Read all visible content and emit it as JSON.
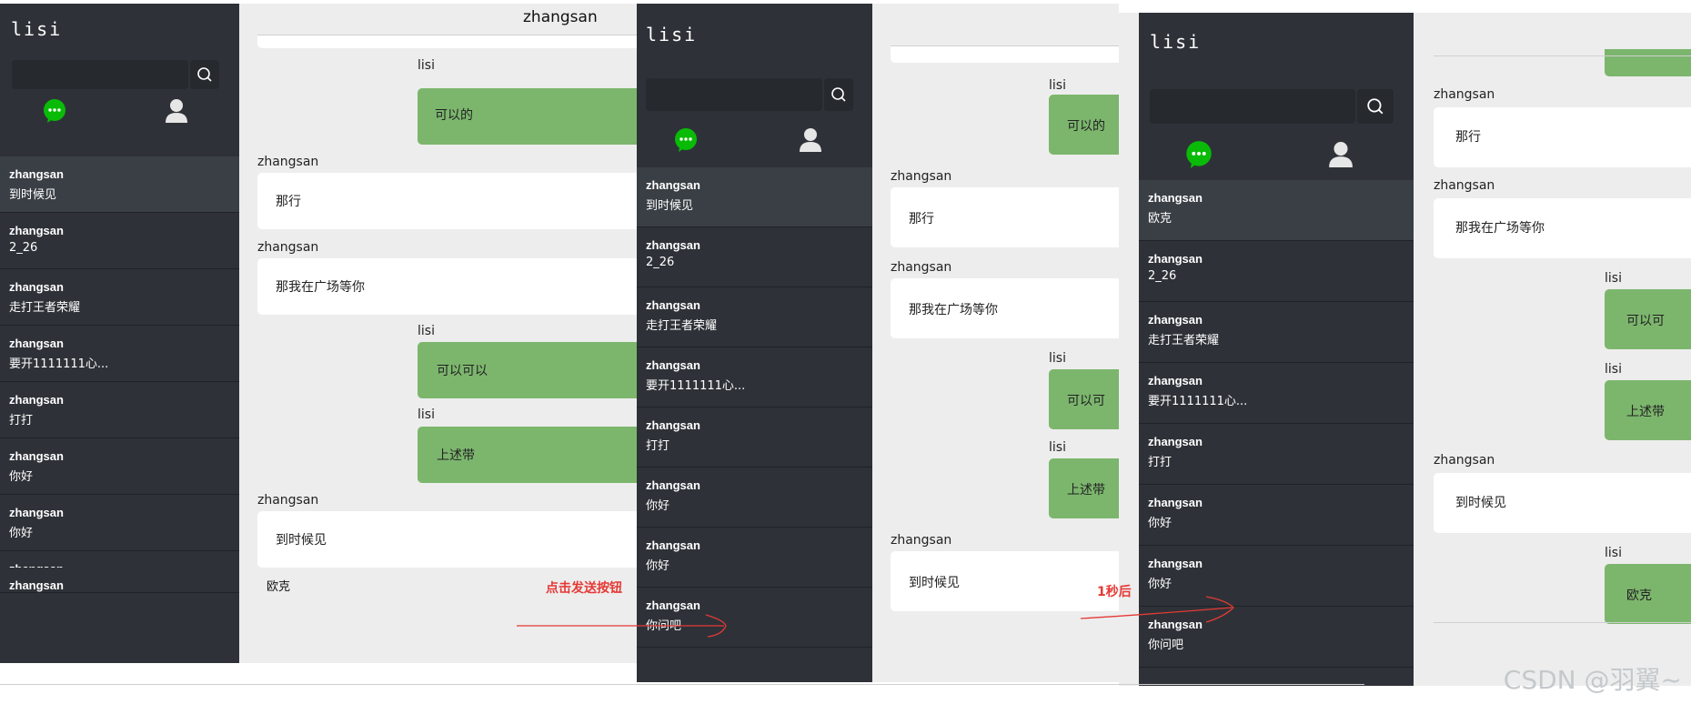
{
  "owner": "lisi",
  "chat_partner": "zhangsan",
  "sidebar_items": [
    {
      "name": "zhangsan",
      "preview": "到时候见"
    },
    {
      "name": "zhangsan",
      "preview": "2_26"
    },
    {
      "name": "zhangsan",
      "preview": "走打王者荣耀"
    },
    {
      "name": "zhangsan",
      "preview": "要开1111111心..."
    },
    {
      "name": "zhangsan",
      "preview": "打打"
    },
    {
      "name": "zhangsan",
      "preview": "你好"
    },
    {
      "name": "zhangsan",
      "preview": "你好"
    },
    {
      "name": "zhangsan",
      "preview": "你问吧"
    },
    {
      "name": "zhangsan",
      "preview": ""
    }
  ],
  "sidebar_items_updated": [
    {
      "name": "zhangsan",
      "preview": "欧克"
    },
    {
      "name": "zhangsan",
      "preview": "2_26"
    },
    {
      "name": "zhangsan",
      "preview": "走打王者荣耀"
    },
    {
      "name": "zhangsan",
      "preview": "要开1111111心..."
    },
    {
      "name": "zhangsan",
      "preview": "打打"
    },
    {
      "name": "zhangsan",
      "preview": "你好"
    },
    {
      "name": "zhangsan",
      "preview": "你好"
    },
    {
      "name": "zhangsan",
      "preview": "你问吧"
    }
  ],
  "messages": {
    "m1": {
      "sender": "lisi",
      "text": "可以的"
    },
    "m2": {
      "sender": "zhangsan",
      "text": "那行"
    },
    "m3": {
      "sender": "zhangsan",
      "text": "那我在广场等你"
    },
    "m4": {
      "sender": "lisi",
      "text": "可以可以"
    },
    "m5": {
      "sender": "lisi",
      "text": "上述带"
    },
    "m6": {
      "sender": "zhangsan",
      "text": "到时候见"
    },
    "m7": {
      "sender": "lisi",
      "text": "欧克"
    },
    "m3_partial": "可以可",
    "m7_partial": "可以可"
  },
  "input_text": "欧克",
  "annotations": {
    "click_send": "点击发送按钮",
    "after_1s": "1秒后"
  },
  "watermark": "CSDN @羽翼~",
  "colors": {
    "sidebar": "#2e3238",
    "bubble_self": "#7cb66d",
    "bubble_other": "#ffffff",
    "annotation": "#e53935"
  }
}
